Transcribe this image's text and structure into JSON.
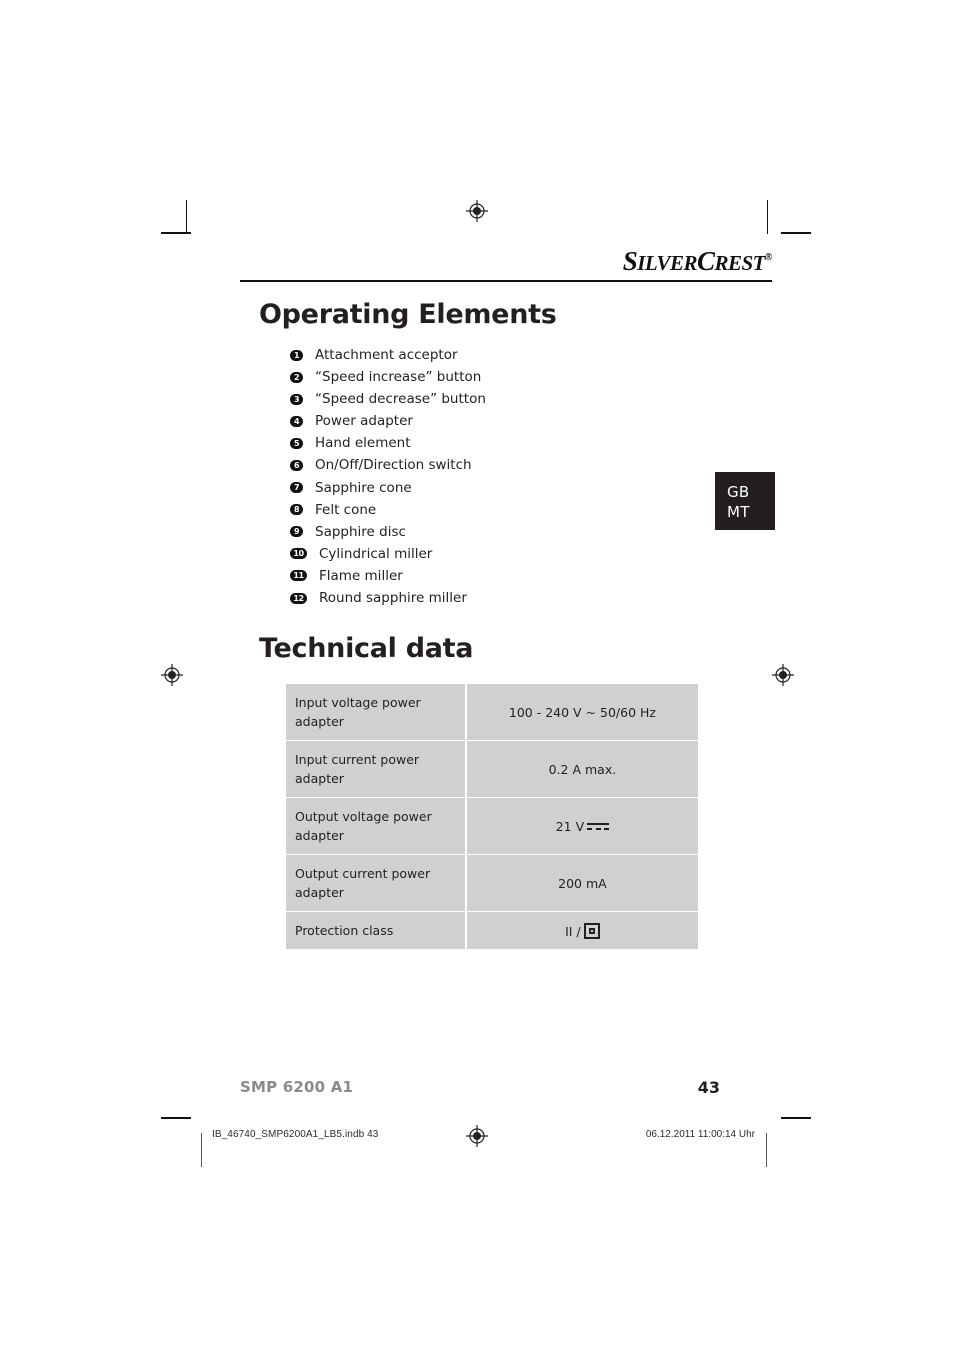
{
  "brand": {
    "logo_lead": "S",
    "logo_first": "ILVER",
    "logo_mid": "C",
    "logo_rest": "REST",
    "trademark": "®"
  },
  "headings": {
    "operating_elements": "Operating Elements",
    "technical_data": "Technical data"
  },
  "operating_elements": [
    {
      "num": "1",
      "label": "Attachment acceptor"
    },
    {
      "num": "2",
      "label": "“Speed increase” button"
    },
    {
      "num": "3",
      "label": "“Speed decrease” button"
    },
    {
      "num": "4",
      "label": "Power adapter"
    },
    {
      "num": "5",
      "label": "Hand element"
    },
    {
      "num": "6",
      "label": "On/Off/Direction switch"
    },
    {
      "num": "7",
      "label": "Sapphire cone"
    },
    {
      "num": "8",
      "label": "Felt cone"
    },
    {
      "num": "9",
      "label": "Sapphire disc"
    },
    {
      "num": "10",
      "label": "Cylindrical miller"
    },
    {
      "num": "11",
      "label": "Flame miller"
    },
    {
      "num": "12",
      "label": "Round sapphire miller"
    }
  ],
  "language_tab": {
    "line1": "GB",
    "line2": "MT"
  },
  "technical_table": {
    "rows": [
      {
        "key": "Input voltage power adapter",
        "value": "100 - 240 V ~ 50/60 Hz",
        "symbol": "none"
      },
      {
        "key": "Input current power adapter",
        "value": "0.2 A max.",
        "symbol": "none"
      },
      {
        "key": "Output voltage power adapter",
        "value": "21 V",
        "symbol": "dc"
      },
      {
        "key": "Output current power adapter",
        "value": "200 mA",
        "symbol": "none"
      },
      {
        "key": "Protection class",
        "value": "II /",
        "symbol": "class2"
      }
    ]
  },
  "footer": {
    "model": "SMP 6200 A1",
    "page_number": "43",
    "file_name": "IB_46740_SMP6200A1_LB5.indb   43",
    "print_date": "06.12.2011   11:00:14 Uhr"
  },
  "colors": {
    "table_cell": "#cfd0d2",
    "ink": "#231f20",
    "tab_background": "#231f20",
    "footer_model": "#8a8a8e"
  }
}
